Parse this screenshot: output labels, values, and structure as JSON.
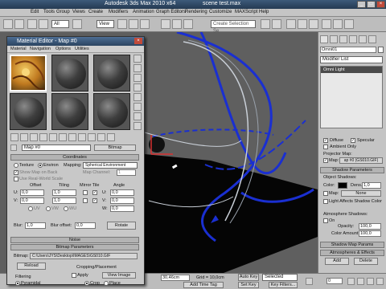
{
  "titlebar": {
    "app": "Autodesk 3ds Max  2010 x64",
    "file": "scene test.max"
  },
  "menubar": [
    "Edit",
    "Tools",
    "Group",
    "Views",
    "Create",
    "Modifiers",
    "Animation",
    "Graph Editors",
    "Rendering",
    "Customize",
    "MAXScript",
    "Help"
  ],
  "toolbar": {
    "filter": "All",
    "view": "View",
    "selection_set": "Create Selection Se"
  },
  "material_editor": {
    "title": "Material Editor - Map #0",
    "menu": [
      "Material",
      "Navigation",
      "Options",
      "Utilities"
    ],
    "map_name": "Map #0",
    "map_type": "Bitmap",
    "coordinates": {
      "header": "Coordinates",
      "texture": "Texture",
      "environ": "Environ",
      "mapping_label": "Mapping:",
      "mapping_value": "Spherical Environment",
      "show_map": "Show Map on Back",
      "map_channel_label": "Map Channel:",
      "map_channel_value": "1",
      "real_world": "Use Real-World Scale",
      "offset": "Offset",
      "tiling": "Tiling",
      "mirror_tile": "Mirror Tile",
      "angle": "Angle",
      "u_offset": "0,0",
      "u_tiling": "1,0",
      "u_angle": "0,0",
      "v_offset": "0,0",
      "v_tiling": "1,0",
      "v_angle": "0,0",
      "w_angle": "0,0",
      "uv": "UV",
      "vw": "VW",
      "wu": "WU",
      "blur_label": "Blur:",
      "blur_value": "1,0",
      "blur_offset_label": "Blur offset:",
      "blur_offset_value": "0,0",
      "rotate": "Rotate"
    },
    "noise": "Noise",
    "bitmap_params": {
      "header": "Bitmap Parameters",
      "bitmap_label": "Bitmap:",
      "bitmap_path": "C:\\Users\\JYS\\Desktop\\IMAGES\\GS010.GIF",
      "reload": "Reload",
      "cropping": "Cropping/Placement",
      "apply": "Apply",
      "view_image": "View Image",
      "crop": "Crop",
      "place": "Place",
      "filtering": "Filtering",
      "pyramidal": "Pyramidal"
    }
  },
  "command_panel": {
    "object_name": "Omni01",
    "modifier_list": "Modifier List",
    "stack_item": "Omni Light",
    "diffuse": "Diffuse",
    "specular": "Specular",
    "ambient_only": "Ambient Only",
    "projector_map": "Projector Map:",
    "map_checkbox": "Map:",
    "map_value": "ap #0 (GS010.GIF)",
    "shadow_params": "Shadow Parameters",
    "object_shadows": "Object Shadows:",
    "color_label": "Color:",
    "dens_label": "Dens.",
    "dens_value": "1,0",
    "map_label": "Map:",
    "map_none": "None",
    "light_affects": "Light Affects Shadow Color",
    "atmosphere_shadows": "Atmosphere Shadows:",
    "on": "On",
    "opacity_label": "Opacity:",
    "opacity_value": "100,0",
    "color_amount_label": "Color Amount:",
    "color_amount_value": "100,0",
    "shadow_map_params": "Shadow Map Params",
    "atmospheres_effects": "Atmospheres & Effects",
    "add": "Add",
    "delete": "Delete"
  },
  "statusbar": {
    "x_value": "30,46cm",
    "grid": "Grid = 10,0cm",
    "auto_key": "Auto Key",
    "selected": "Selected",
    "set_key": "Set Key",
    "key_filters": "Key Filters...",
    "add_time_tag": "Add Time Tag",
    "frame": "0"
  },
  "colors": {
    "viewport_bg": "#5f5f5f",
    "spline_blue": "#1a2fd1",
    "panel_gray": "#c4c4c4",
    "title_blue": "#2b4461"
  }
}
